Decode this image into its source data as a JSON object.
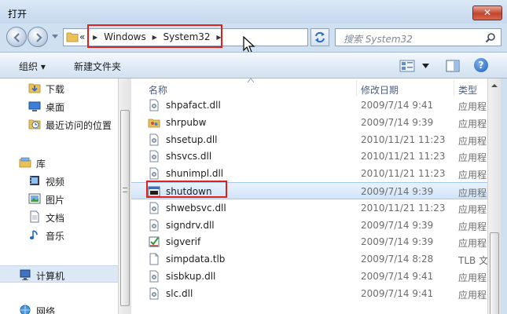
{
  "window": {
    "title": "打开",
    "close_label": "✕"
  },
  "address": {
    "crumb_prefix": "«",
    "crumbs": [
      "Windows",
      "System32"
    ],
    "search_placeholder": "搜索 System32"
  },
  "toolbar": {
    "organize": "组织 ▾",
    "new_folder": "新建文件夹",
    "help": "?"
  },
  "nav": {
    "items": [
      {
        "label": "下载",
        "icon": "download-folder-icon"
      },
      {
        "label": "桌面",
        "icon": "desktop-icon"
      },
      {
        "label": "最近访问的位置",
        "icon": "recent-places-icon"
      },
      {
        "label": "库",
        "icon": "libraries-icon"
      },
      {
        "label": "视频",
        "icon": "videos-icon"
      },
      {
        "label": "图片",
        "icon": "pictures-icon"
      },
      {
        "label": "文档",
        "icon": "documents-icon"
      },
      {
        "label": "音乐",
        "icon": "music-icon"
      },
      {
        "label": "计算机",
        "icon": "computer-icon"
      },
      {
        "label": "网络",
        "icon": "network-icon"
      }
    ]
  },
  "files": {
    "columns": {
      "name": "名称",
      "date": "修改日期",
      "type": "类型"
    },
    "rows": [
      {
        "name": "shpafact.dll",
        "date": "2009/7/14 9:41",
        "type": "应用程",
        "icon": "dll-file-icon"
      },
      {
        "name": "shrpubw",
        "date": "2009/7/14 9:39",
        "type": "应用程",
        "icon": "shared-folder-wizard-icon"
      },
      {
        "name": "shsetup.dll",
        "date": "2010/11/21 11:23",
        "type": "应用程",
        "icon": "dll-file-icon"
      },
      {
        "name": "shsvcs.dll",
        "date": "2010/11/21 11:23",
        "type": "应用程",
        "icon": "dll-file-icon"
      },
      {
        "name": "shunimpl.dll",
        "date": "2010/11/21 11:23",
        "type": "应用程",
        "icon": "dll-file-icon"
      },
      {
        "name": "shutdown",
        "date": "2009/7/14 9:39",
        "type": "应用程",
        "icon": "console-app-icon",
        "selected": true
      },
      {
        "name": "shwebsvc.dll",
        "date": "2010/11/21 11:23",
        "type": "应用程",
        "icon": "dll-file-icon"
      },
      {
        "name": "signdrv.dll",
        "date": "2009/7/14 9:39",
        "type": "应用程",
        "icon": "dll-file-icon"
      },
      {
        "name": "sigverif",
        "date": "2009/7/14 9:39",
        "type": "应用程",
        "icon": "sigverif-app-icon"
      },
      {
        "name": "simpdata.tlb",
        "date": "2009/7/14 8:28",
        "type": "TLB 文",
        "icon": "tlb-file-icon"
      },
      {
        "name": "sisbkup.dll",
        "date": "2009/7/14 9:41",
        "type": "应用程",
        "icon": "dll-file-icon"
      },
      {
        "name": "slc.dll",
        "date": "2009/7/14 9:41",
        "type": "应用程",
        "icon": "dll-file-icon"
      }
    ]
  },
  "colors": {
    "highlight": "#e0201a",
    "selection": "#d1e4f9"
  }
}
